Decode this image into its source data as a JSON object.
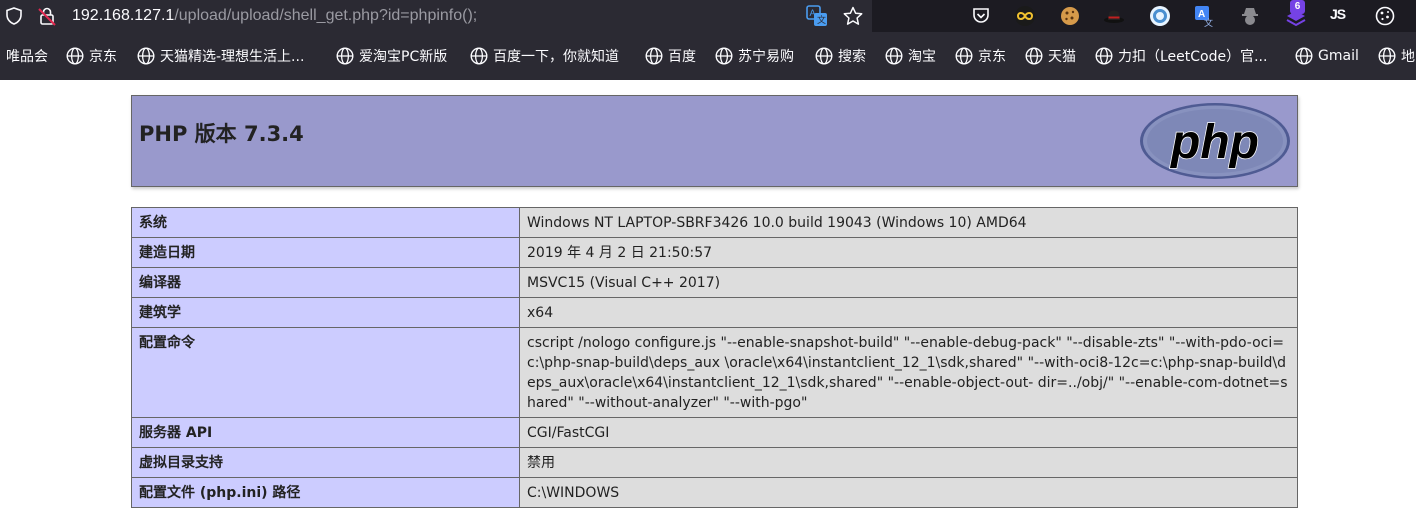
{
  "browser": {
    "url_host": "192.168.127.1",
    "url_path": "/upload/upload/shell_get.php?id=phpinfo();",
    "extension_badge": "6",
    "extension_js_label": "JS"
  },
  "bookmarks": [
    {
      "label": "唯品会",
      "icon": false
    },
    {
      "label": "京东",
      "icon": true
    },
    {
      "label": "天猫精选-理想生活上...",
      "icon": true
    },
    {
      "label": "爱淘宝PC新版",
      "icon": true
    },
    {
      "label": "百度一下，你就知道",
      "icon": true
    },
    {
      "label": "百度",
      "icon": true
    },
    {
      "label": "苏宁易购",
      "icon": true
    },
    {
      "label": "搜索",
      "icon": true
    },
    {
      "label": "淘宝",
      "icon": true
    },
    {
      "label": "京东",
      "icon": true
    },
    {
      "label": "天猫",
      "icon": true
    },
    {
      "label": "力扣（LeetCode）官...",
      "icon": true
    },
    {
      "label": "Gmail",
      "icon": true
    },
    {
      "label": "地",
      "icon": true
    }
  ],
  "php": {
    "title": "PHP 版本 7.3.4",
    "logo_text": "php"
  },
  "info_rows": [
    {
      "key": "系统",
      "value": "Windows NT LAPTOP-SBRF3426 10.0 build 19043 (Windows 10) AMD64"
    },
    {
      "key": "建造日期",
      "value": "2019 年 4 月 2 日 21:50:57"
    },
    {
      "key": "编译器",
      "value": "MSVC15 (Visual C++ 2017)"
    },
    {
      "key": "建筑学",
      "value": "x64"
    },
    {
      "key": "配置命令",
      "value": "cscript /nologo configure.js \"--enable-snapshot-build\" \"--enable-debug-pack\" \"--disable-zts\" \"--with-pdo-oci=c:\\php-snap-build\\deps_aux \\oracle\\x64\\instantclient_12_1\\sdk,shared\" \"--with-oci8-12c=c:\\php-snap-build\\deps_aux\\oracle\\x64\\instantclient_12_1\\sdk,shared\" \"--enable-object-out- dir=../obj/\" \"--enable-com-dotnet=shared\" \"--without-analyzer\" \"--with-pgo\""
    },
    {
      "key": "服务器 API",
      "value": "CGI/FastCGI"
    },
    {
      "key": "虚拟目录支持",
      "value": "禁用"
    },
    {
      "key": "配置文件 (php.ini) 路径",
      "value": "C:\\WINDOWS"
    }
  ]
}
